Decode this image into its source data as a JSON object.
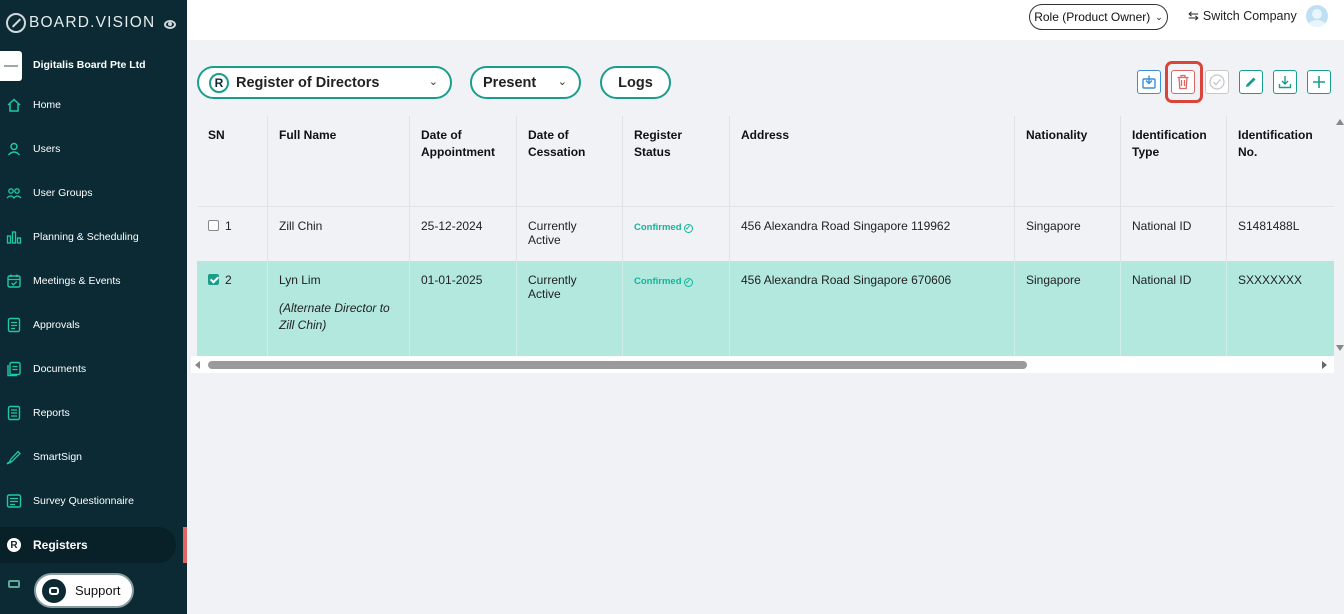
{
  "brand": {
    "name": "BOARD.VISION"
  },
  "company": {
    "name": "Digitalis Board Pte Ltd"
  },
  "sidebar": {
    "items": [
      {
        "label": "Home",
        "icon": "home-icon"
      },
      {
        "label": "Users",
        "icon": "user-icon"
      },
      {
        "label": "User Groups",
        "icon": "user-group-icon"
      },
      {
        "label": "Planning & Scheduling",
        "icon": "chart-icon"
      },
      {
        "label": "Meetings & Events",
        "icon": "calendar-icon"
      },
      {
        "label": "Approvals",
        "icon": "approval-icon"
      },
      {
        "label": "Documents",
        "icon": "document-icon"
      },
      {
        "label": "Reports",
        "icon": "report-icon"
      },
      {
        "label": "SmartSign",
        "icon": "pen-icon"
      },
      {
        "label": "Survey Questionnaire",
        "icon": "survey-icon"
      },
      {
        "label": "Registers",
        "icon": "register-icon",
        "active": true
      }
    ],
    "register_badge": "R",
    "support_label": "Support"
  },
  "header": {
    "role_label": "Role (Product Owner)",
    "switch_company_label": "Switch Company"
  },
  "toolbar": {
    "register_badge": "R",
    "register_select": "Register of Directors",
    "period_select": "Present",
    "logs_label": "Logs"
  },
  "table": {
    "headers": {
      "sn": "SN",
      "name": "Full Name",
      "doa": "Date of Appointment",
      "doc": "Date of Cessation",
      "status": "Register Status",
      "address": "Address",
      "nationality": "Nationality",
      "id_type": "Identification Type",
      "id_no": "Identification No."
    },
    "rows": [
      {
        "sn": "1",
        "checked": false,
        "name": "Zill Chin",
        "note": "",
        "doa": "25-12-2024",
        "doc": "Currently Active",
        "status": "Confirmed",
        "address": "456 Alexandra Road Singapore 119962",
        "nationality": "Singapore",
        "id_type": "National ID",
        "id_no": "S1481488L"
      },
      {
        "sn": "2",
        "checked": true,
        "name": "Lyn Lim",
        "note": "(Alternate Director to Zill Chin)",
        "doa": "01-01-2025",
        "doc": "Currently Active",
        "status": "Confirmed",
        "address": "456 Alexandra Road Singapore 670606",
        "nationality": "Singapore",
        "id_type": "National ID",
        "id_no": "SXXXXXXX"
      }
    ]
  },
  "colors": {
    "sidebar_bg": "#0b2a33",
    "accent": "#1a9e8c",
    "selected_row": "#b3e8df",
    "confirmed": "#12b59a",
    "delete_highlight": "#d9453a"
  }
}
